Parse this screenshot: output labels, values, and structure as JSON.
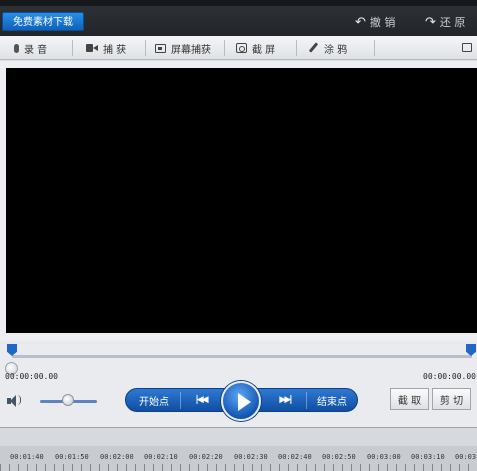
{
  "titlebar": {
    "download_label": "免费素材下载",
    "undo_label": "撤 销",
    "redo_label": "还 原",
    "undo_glyph": "↶",
    "redo_glyph": "↷"
  },
  "toolbar": {
    "record_audio": "录 音",
    "camera": "捕 获",
    "screen_capture": "屏幕捕获",
    "screenshot": "截 屏",
    "brush": "涂 鸦"
  },
  "scrub": {
    "start_time": "00:00:00.00",
    "end_time": "00:00:00.00"
  },
  "controls": {
    "start_point": "开始点",
    "end_point": "结束点",
    "prev_glyph": "|◀◀",
    "next_glyph": "▶▶|",
    "capture": "截 取",
    "cut": "剪 切"
  },
  "ruler": {
    "labels": [
      "00:01:40",
      "00:01:50",
      "00:02:00",
      "00:02:10",
      "00:02:20",
      "00:02:30",
      "00:02:40",
      "00:02:50",
      "00:03:00",
      "00:03:10",
      "00:03"
    ]
  },
  "colors": {
    "accent": "#1a63c4",
    "preview_background": "#000000"
  }
}
